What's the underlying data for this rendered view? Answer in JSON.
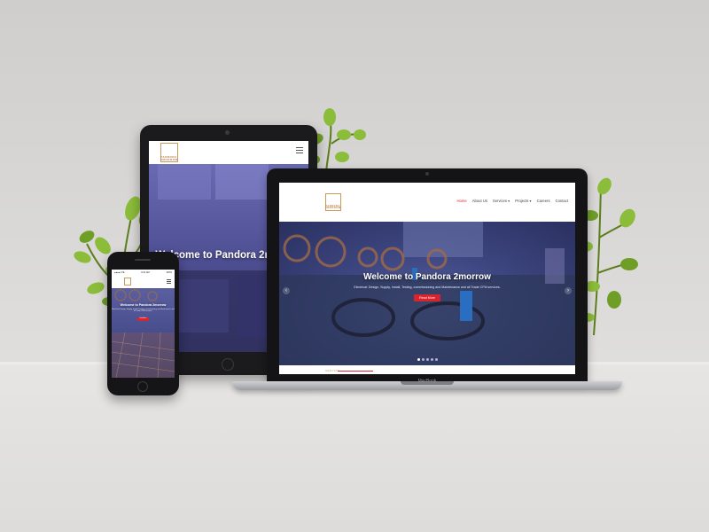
{
  "site": {
    "logo_text": "PANDORA 2MORROW",
    "hero_title": "Welcome to Pandora 2morrow",
    "hero_title_tablet": "Welcome to Pandora 2morrow",
    "hero_subtitle": "Electrical: Design, Supply, Install, Testing, commissioning and Maintenance and all Trade CFM services.",
    "hero_button": "Read More",
    "section_label": "SERVICE",
    "nav": [
      {
        "label": "Home",
        "active": true
      },
      {
        "label": "About Us"
      },
      {
        "label": "Services ▾"
      },
      {
        "label": "Projects ▾"
      },
      {
        "label": "Careers"
      },
      {
        "label": "Contact"
      }
    ],
    "slider_dots": 5,
    "slider_active_dot": 0
  },
  "phone_status": {
    "left": "●●●● LTE",
    "time": "9:41 AM",
    "right": "100%"
  },
  "laptop_brand": "MacBook",
  "colors": {
    "accent": "#d9232d",
    "logo": "#c07a3a",
    "hero_tint": "#3d4680"
  },
  "icons": {
    "prev": "chevron-left-icon",
    "next": "chevron-right-icon",
    "menu": "hamburger-icon"
  }
}
